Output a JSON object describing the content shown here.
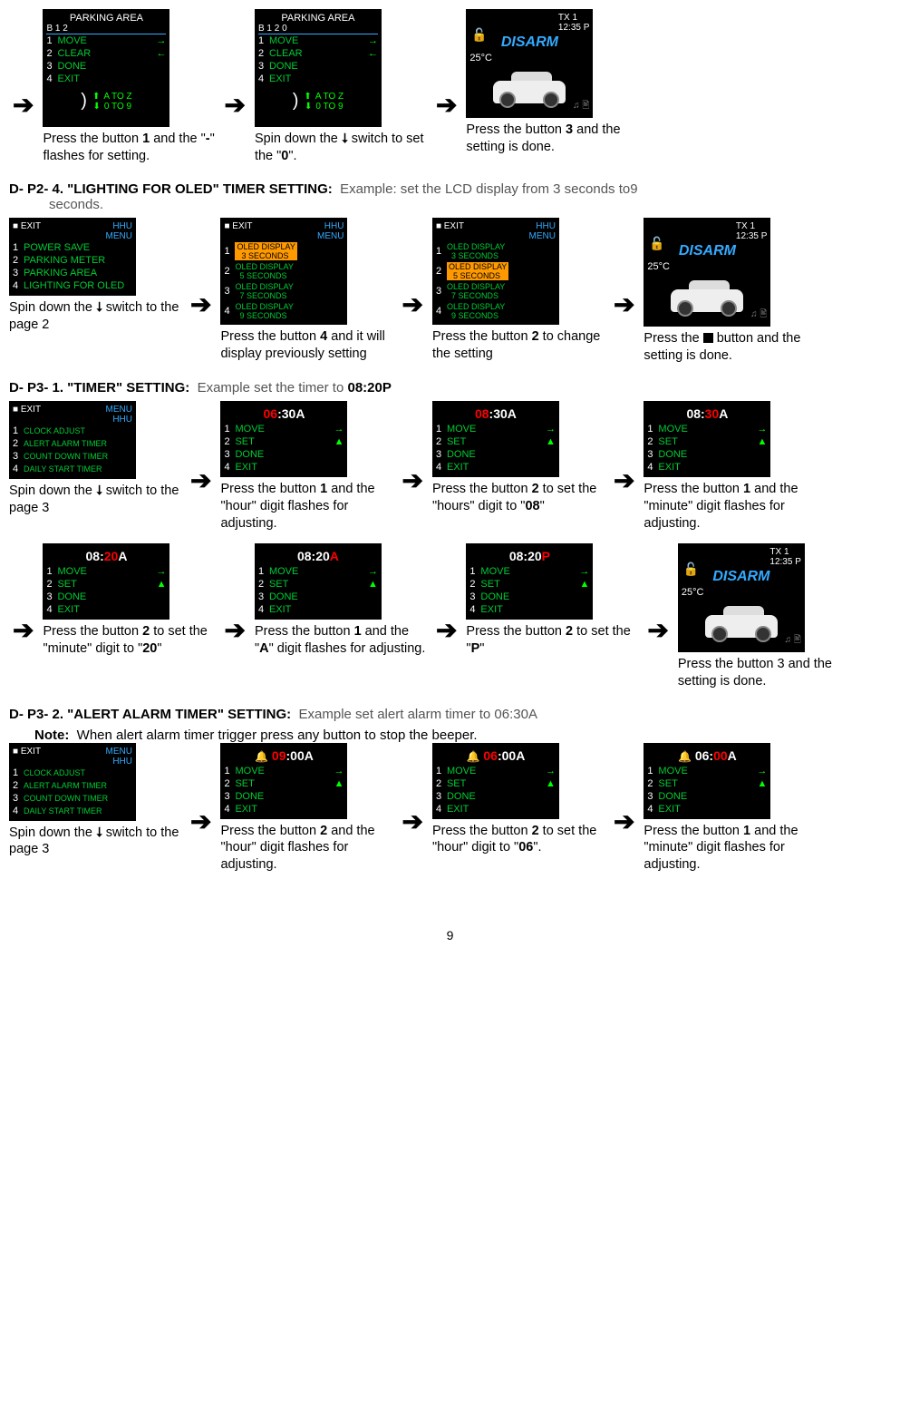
{
  "s1": {
    "parking_title": "PARKING AREA",
    "b12": "B 1 2",
    "b120": "B 1 2 0",
    "menu": [
      "MOVE",
      "CLEAR",
      "DONE",
      "EXIT"
    ],
    "atoz": "A TO Z",
    "zto9": "0 TO 9",
    "cap1a": "Press the button ",
    "cap1b": "1",
    "cap1c": " and the \"",
    "cap1d": "-",
    "cap1e": "\" flashes for setting.",
    "cap2a": "Spin down the ",
    "cap2b": " switch to set the \"",
    "cap2c": "0",
    "cap2d": "\".",
    "cap3a": "Press the button ",
    "cap3b": "3",
    "cap3c": " and the setting is done."
  },
  "disarm": {
    "tx": "TX 1",
    "time": "12:35 P",
    "title": "DISARM",
    "temp": "25°C"
  },
  "h1": {
    "pre": "D- P2- 4. \"LIGHTING FOR OLED\" TIMER SETTING:",
    "ex": "Example: set the LCD display from 3 seconds to9",
    "sub": "seconds."
  },
  "s2": {
    "exit": "EXIT",
    "hhu": "HHU",
    "menutxt": "MENU",
    "page2": [
      "POWER SAVE",
      "PARKING METER",
      "PARKING AREA",
      "LIGHTING FOR OLED"
    ],
    "oled": [
      "OLED DISPLAY",
      "3 SECONDS",
      "OLED DISPLAY",
      "5 SECONDS",
      "OLED DISPLAY",
      "7 SECONDS",
      "OLED DISPLAY",
      "9 SECONDS"
    ],
    "cap1a": "Spin down the ",
    "cap1b": " switch to the page 2",
    "cap2a": "Press the button ",
    "cap2b": "4",
    "cap2c": " and it will display previously setting",
    "cap3a": "Press the button ",
    "cap3b": "2",
    "cap3c": " to change the setting",
    "cap4a": "Press the ",
    "cap4b": " button and the setting is done."
  },
  "h2": {
    "pre": "D- P3- 1. \"TIMER\" SETTING:",
    "ex": "Example set the timer to ",
    "exb": "08:20P"
  },
  "s3": {
    "page3": [
      "CLOCK ADJUST",
      "ALERT ALARM TIMER",
      "COUNT DOWN TIMER",
      "DAILY START TIMER"
    ],
    "menu4": [
      "MOVE",
      "SET",
      "DONE",
      "EXIT"
    ],
    "t1a": "06",
    "t1b": ":30A",
    "t2a": "08",
    "t2b": ":30A",
    "t3a": "08:",
    "t3b": "30",
    "t3c": "A",
    "t4a": "08:",
    "t4b": "20",
    "t4c": "A",
    "t5a": "08:20",
    "t5b": "A",
    "t6a": "08:20",
    "t6b": "P",
    "cap1a": "Spin down the ",
    "cap1b": " switch to the page 3",
    "cap2a": "Press the button ",
    "cap2b": "1",
    "cap2c": " and the \"hour\" digit flashes for adjusting.",
    "cap3a": "Press the button ",
    "cap3b": "2",
    "cap3c": " to set the \"hours\" digit to \"",
    "cap3d": "08",
    "cap3e": "\"",
    "cap4a": "Press the button ",
    "cap4b": "1",
    "cap4c": " and the \"minute\" digit flashes for adjusting.",
    "cap5a": "Press the button ",
    "cap5b": "2",
    "cap5c": " to set the \"minute\" digit to \"",
    "cap5d": "20",
    "cap5e": "\"",
    "cap6a": "Press the button ",
    "cap6b": "1",
    "cap6c": " and the \"",
    "cap6d": "A",
    "cap6e": "\" digit flashes for adjusting.",
    "cap7a": "Press the button ",
    "cap7b": "2",
    "cap7c": " to set the \"",
    "cap7d": "P",
    "cap7e": "\"",
    "cap8a": "Press the button 3 and the setting is done."
  },
  "h3": {
    "pre": "D- P3- 2. \"ALERT ALARM TIMER\" SETTING:",
    "ex": "Example set alert alarm timer to 06:30A"
  },
  "note": {
    "a": "Note:",
    "b": "When alert alarm timer trigger press any button to stop the beeper."
  },
  "s4": {
    "t1a": "09",
    "t1b": ":00A",
    "t2a": "06",
    "t2b": ":00A",
    "t3a": "06:",
    "t3b": "00",
    "t3c": "A",
    "cap1a": "Spin down the ",
    "cap1b": " switch to the page 3",
    "cap2a": "Press the button ",
    "cap2b": "2",
    "cap2c": " and the \"hour\" digit flashes for adjusting.",
    "cap3a": "Press the button ",
    "cap3b": "2",
    "cap3c": " to set the \"hour\" digit to \"",
    "cap3d": "06",
    "cap3e": "\".",
    "cap4a": "Press the button ",
    "cap4b": "1",
    "cap4c": " and the \"minute\" digit flashes for adjusting."
  },
  "pageno": "9"
}
